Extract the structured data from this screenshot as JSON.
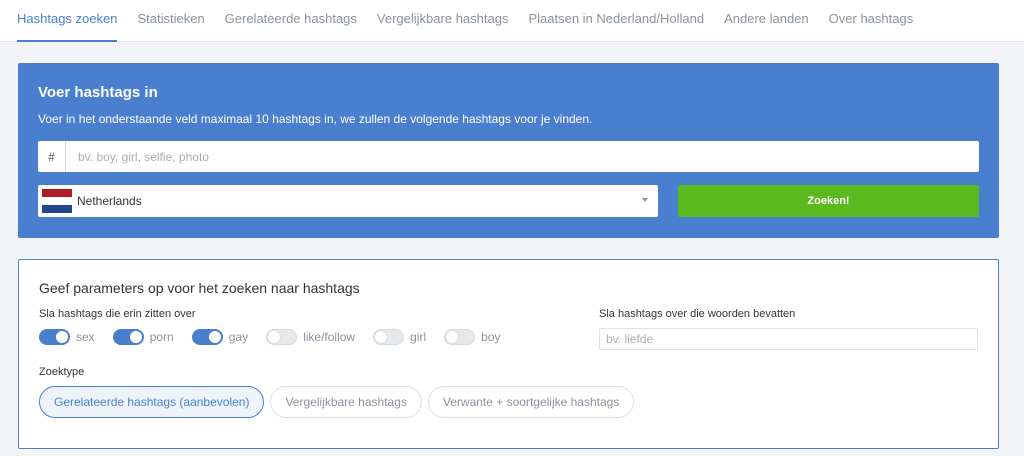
{
  "tabs": [
    {
      "label": "Hashtags zoeken",
      "active": true
    },
    {
      "label": "Statistieken",
      "active": false
    },
    {
      "label": "Gerelateerde hashtags",
      "active": false
    },
    {
      "label": "Vergelijkbare hashtags",
      "active": false
    },
    {
      "label": "Plaatsen in Nederland/Holland",
      "active": false
    },
    {
      "label": "Andere landen",
      "active": false
    },
    {
      "label": "Over hashtags",
      "active": false
    }
  ],
  "search": {
    "title": "Voer hashtags in",
    "description": "Voer in het onderstaande veld maximaal 10 hashtags in, we zullen de volgende hashtags voor je vinden.",
    "prefix": "#",
    "placeholder": "bv. boy, girl, selfie, photo",
    "value": "",
    "country": "Netherlands",
    "button_label": "Zoeken!"
  },
  "params": {
    "title": "Geef parameters op voor het zoeken naar hashtags",
    "skip_label": "Sla hashtags die erin zitten over",
    "toggles": [
      {
        "label": "sex",
        "on": true
      },
      {
        "label": "porn",
        "on": true
      },
      {
        "label": "gay",
        "on": true
      },
      {
        "label": "like/follow",
        "on": false
      },
      {
        "label": "girl",
        "on": false
      },
      {
        "label": "boy",
        "on": false
      }
    ],
    "words_label": "Sla hashtags over die woorden bevatten",
    "words_placeholder": "bv. liefde",
    "type_label": "Zoektype",
    "types": [
      {
        "label": "Gerelateerde hashtags (aanbevolen)",
        "active": true
      },
      {
        "label": "Vergelijkbare hashtags",
        "active": false
      },
      {
        "label": "Verwante + soortgelijke hashtags",
        "active": false
      }
    ]
  },
  "colors": {
    "accent": "#4a7fd0",
    "button_green": "#5cb81f",
    "flag_red": "#ae1c28",
    "flag_white": "#ffffff",
    "flag_blue": "#21468b"
  }
}
